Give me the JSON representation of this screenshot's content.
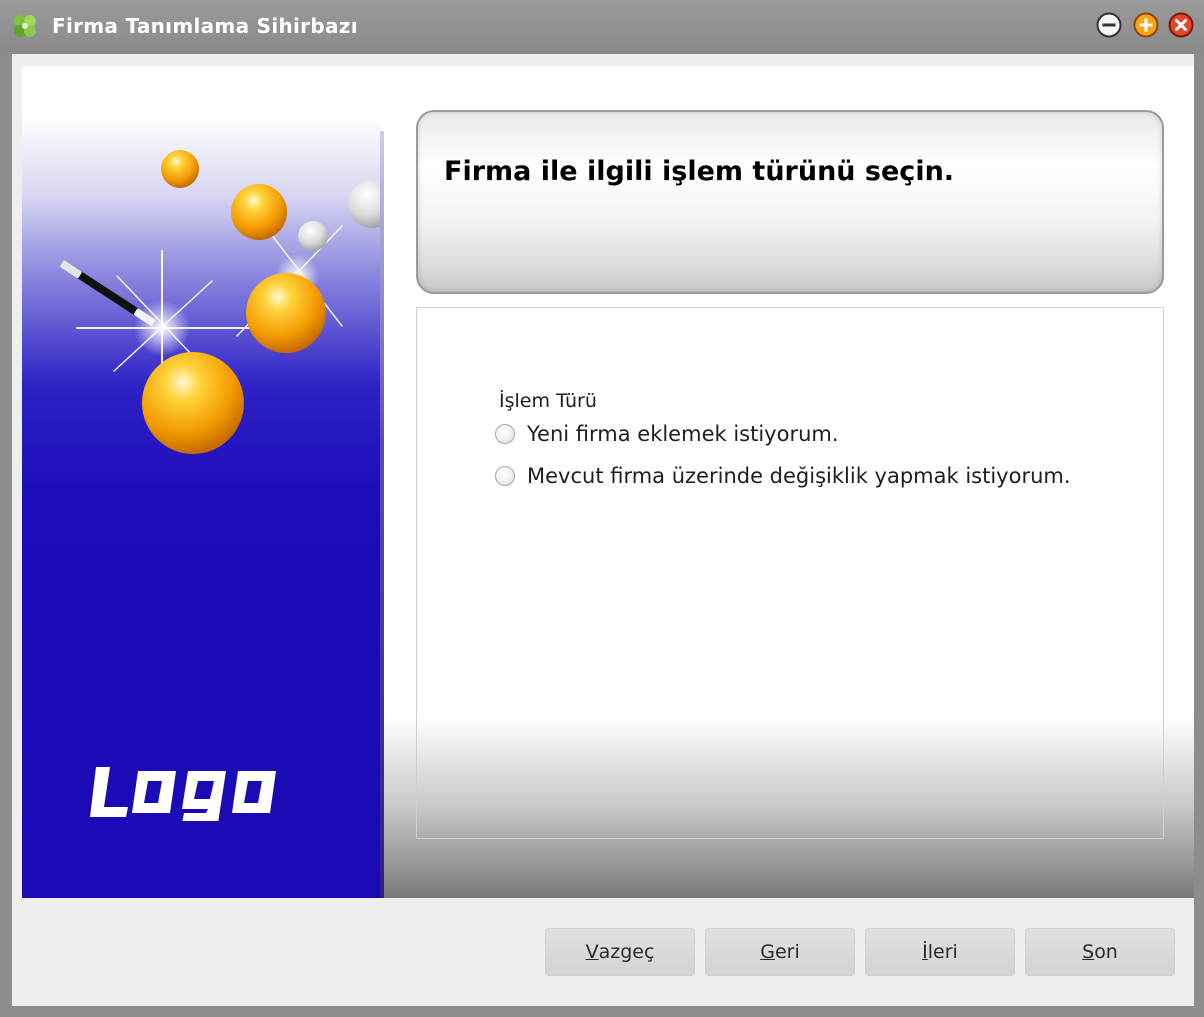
{
  "window": {
    "title": "Firma Tanımlama Sihirbazı",
    "app_icon": "clover-icon",
    "controls": [
      "minimize-icon",
      "maximize-icon",
      "close-icon"
    ]
  },
  "sidebar": {
    "logo_text": "logo",
    "decoration": "magic-wand-and-spheres"
  },
  "header": {
    "title": "Firma ile ilgili işlem türünü seçin."
  },
  "operation_type": {
    "label": "İşlem Türü",
    "options": [
      {
        "label": "Yeni firma eklemek istiyorum.",
        "selected": false
      },
      {
        "label": "Mevcut firma üzerinde değişiklik yapmak istiyorum.",
        "selected": false
      }
    ]
  },
  "buttons": {
    "cancel": {
      "mnemonic": "V",
      "rest": "azgeç"
    },
    "back": {
      "mnemonic": "G",
      "rest": "eri"
    },
    "next": {
      "mnemonic": "İ",
      "rest": "leri"
    },
    "finish": {
      "mnemonic": "S",
      "rest": "on"
    }
  },
  "colors": {
    "titlebar": "#8d8d8d",
    "sidebar_blue": "#1a0ab4",
    "sphere_orange": "#f5a400"
  }
}
